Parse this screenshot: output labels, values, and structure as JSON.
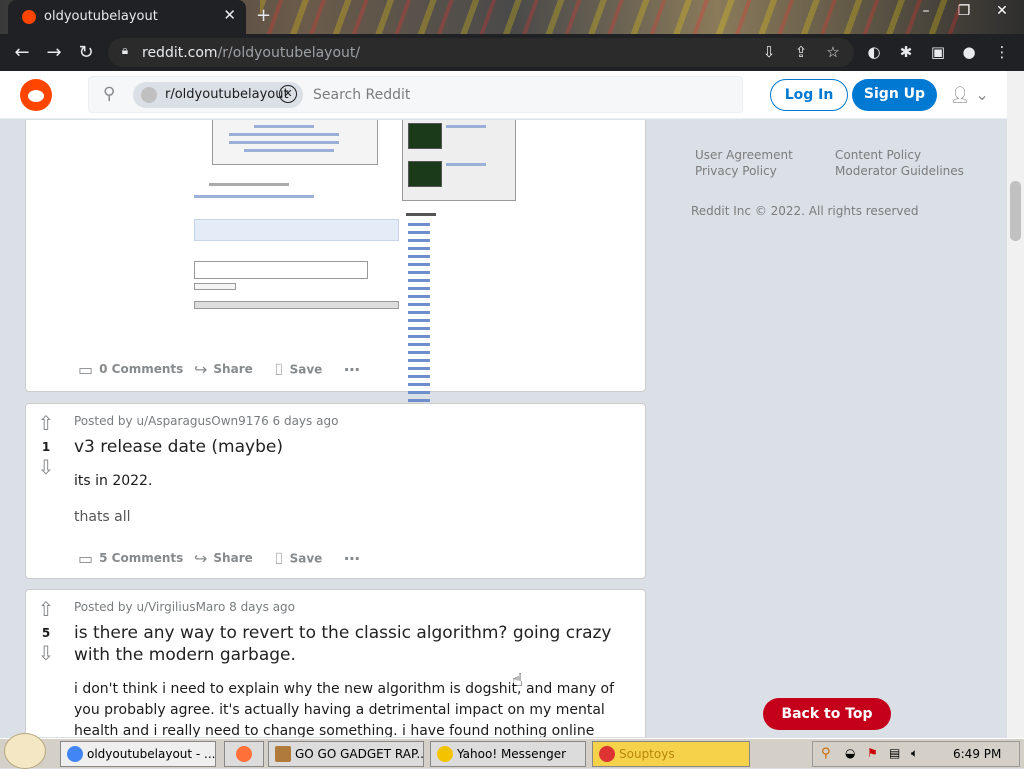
{
  "browser": {
    "tab_title": "oldyoutubelayout",
    "url_host": "reddit.com",
    "url_path": "/r/oldyoutubelayout/"
  },
  "header": {
    "community_chip": "r/oldyoutubelayout",
    "search_placeholder": "Search Reddit",
    "login_label": "Log In",
    "signup_label": "Sign Up"
  },
  "posts": [
    {
      "comments": "0 Comments",
      "share": "Share",
      "save": "Save"
    },
    {
      "score": "1",
      "meta": "Posted by u/AsparagusOwn9176 6 days ago",
      "title": "v3 release date (maybe)",
      "body1": "its in 2022.",
      "body2": "thats all",
      "comments": "5 Comments",
      "share": "Share",
      "save": "Save"
    },
    {
      "score": "5",
      "meta": "Posted by u/VirgiliusMaro 8 days ago",
      "title": "is there any way to revert to the classic algorithm? going crazy with the modern garbage.",
      "body": "i don't think i need to explain why the new algorithm is dogshit, and many of you probably agree. it's actually having a detrimental impact on my mental health and i really need to change something. i have found nothing online about this, but has"
    }
  ],
  "sidebar": {
    "links": [
      "User Agreement",
      "Content Policy",
      "Privacy Policy",
      "Moderator Guidelines"
    ],
    "copyright": "Reddit Inc © 2022. All rights reserved"
  },
  "back_to_top": "Back to Top",
  "taskbar": {
    "tasks": [
      "oldyoutubelayout - ...",
      "GO GO GADGET RAP...",
      "Yahoo! Messenger",
      "Souptoys"
    ],
    "clock": "6:49 PM"
  },
  "colors": {
    "reddit_orange": "#ff4500",
    "reddit_blue": "#0079d3",
    "back_to_top": "#c4001a"
  }
}
